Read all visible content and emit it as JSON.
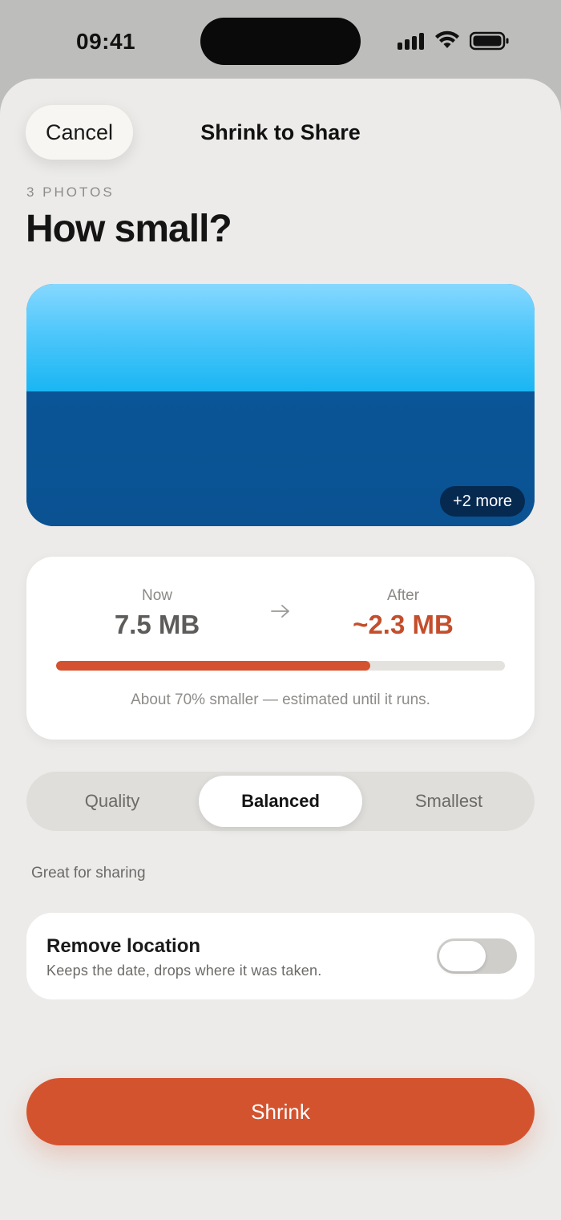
{
  "status_bar": {
    "time": "09:41"
  },
  "header": {
    "cancel_label": "Cancel",
    "title": "Shrink to Share"
  },
  "intro": {
    "eyebrow": "3 PHOTOS",
    "headline": "How small?"
  },
  "preview": {
    "more_badge": "+2 more"
  },
  "size_card": {
    "now_label": "Now",
    "now_value": "7.5 MB",
    "after_label": "After",
    "after_value": "~2.3 MB",
    "progress_fraction": 0.7,
    "note": "About 70% smaller — estimated until it runs."
  },
  "modes": {
    "options": [
      "Quality",
      "Balanced",
      "Smallest"
    ],
    "selected": "Balanced",
    "caption": "Great for sharing"
  },
  "location_toggle": {
    "title": "Remove location",
    "subtitle": "Keeps the date, drops where it was taken.",
    "enabled": false
  },
  "primary_action": {
    "label": "Shrink"
  },
  "colors": {
    "accent": "#d4532f",
    "after_value": "#c44e2c",
    "sheet_background": "#ecebe9"
  }
}
